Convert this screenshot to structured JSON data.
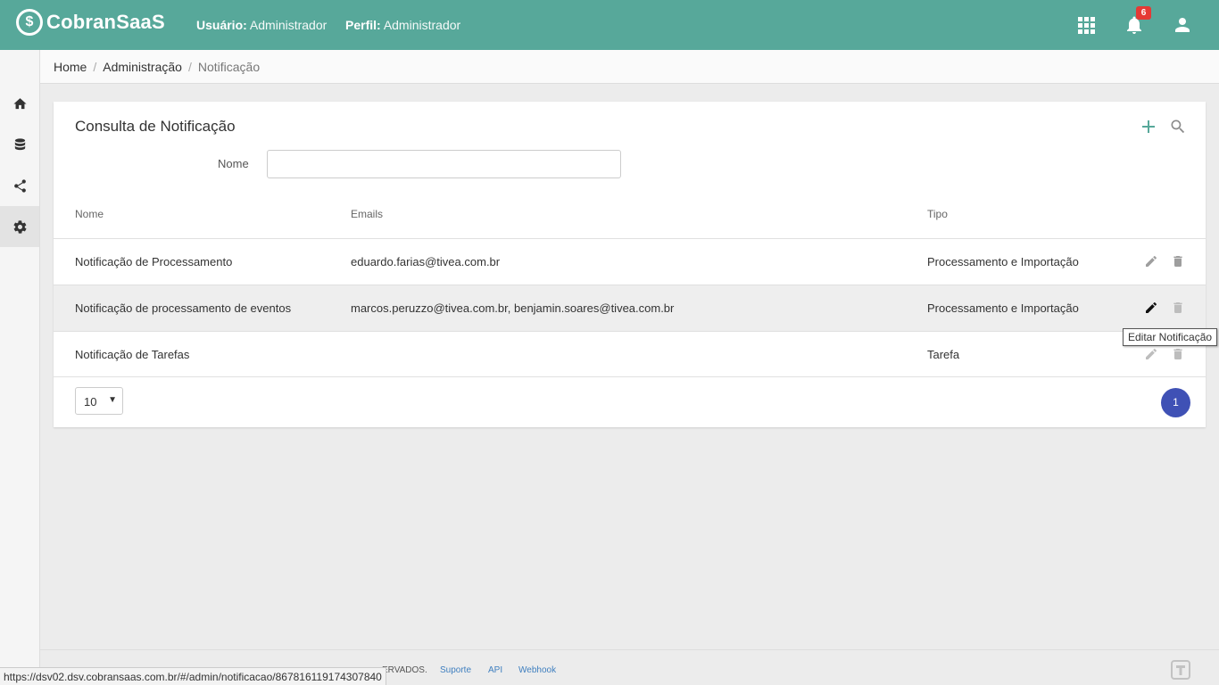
{
  "app": {
    "name": "CobranSaaS",
    "logo_mark": "$"
  },
  "header": {
    "user_label": "Usuário:",
    "user_value": "Administrador",
    "profile_label": "Perfil:",
    "profile_value": "Administrador",
    "notifications_count": "6",
    "icons": [
      "apps-grid-icon",
      "bell-icon",
      "user-icon"
    ]
  },
  "sidebar": {
    "items": [
      "home-icon",
      "database-icon",
      "share-icon",
      "gear-icon"
    ],
    "active": "gear-icon"
  },
  "breadcrumb": {
    "items": [
      "Home",
      "Administração",
      "Notificação"
    ],
    "separator": "/"
  },
  "card": {
    "title": "Consulta de Notificação",
    "filter": {
      "label": "Nome",
      "value": "",
      "placeholder": ""
    },
    "columns": {
      "nome": "Nome",
      "emails": "Emails",
      "tipo": "Tipo"
    },
    "rows": [
      {
        "nome": "Notificação de Processamento",
        "emails": "eduardo.farias@tivea.com.br",
        "tipo": "Processamento e Importação"
      },
      {
        "nome": "Notificação de processamento de eventos",
        "emails": "marcos.peruzzo@tivea.com.br, benjamin.soares@tivea.com.br",
        "tipo": "Processamento e Importação"
      },
      {
        "nome": "Notificação de Tarefas",
        "emails": "",
        "tipo": "Tarefa"
      }
    ],
    "page_size": "10",
    "current_page": "1",
    "tooltip": "Editar Notificação"
  },
  "footer": {
    "partial_text": "ERVADOS.",
    "links": [
      "Suporte",
      "API",
      "Webhook"
    ]
  },
  "status_url": "https://dsv02.dsv.cobransaas.com.br/#/admin/notificacao/867816119174307840",
  "colors": {
    "topbar": "#57a89a",
    "accent": "#3f51b5",
    "badge": "#e53935"
  }
}
